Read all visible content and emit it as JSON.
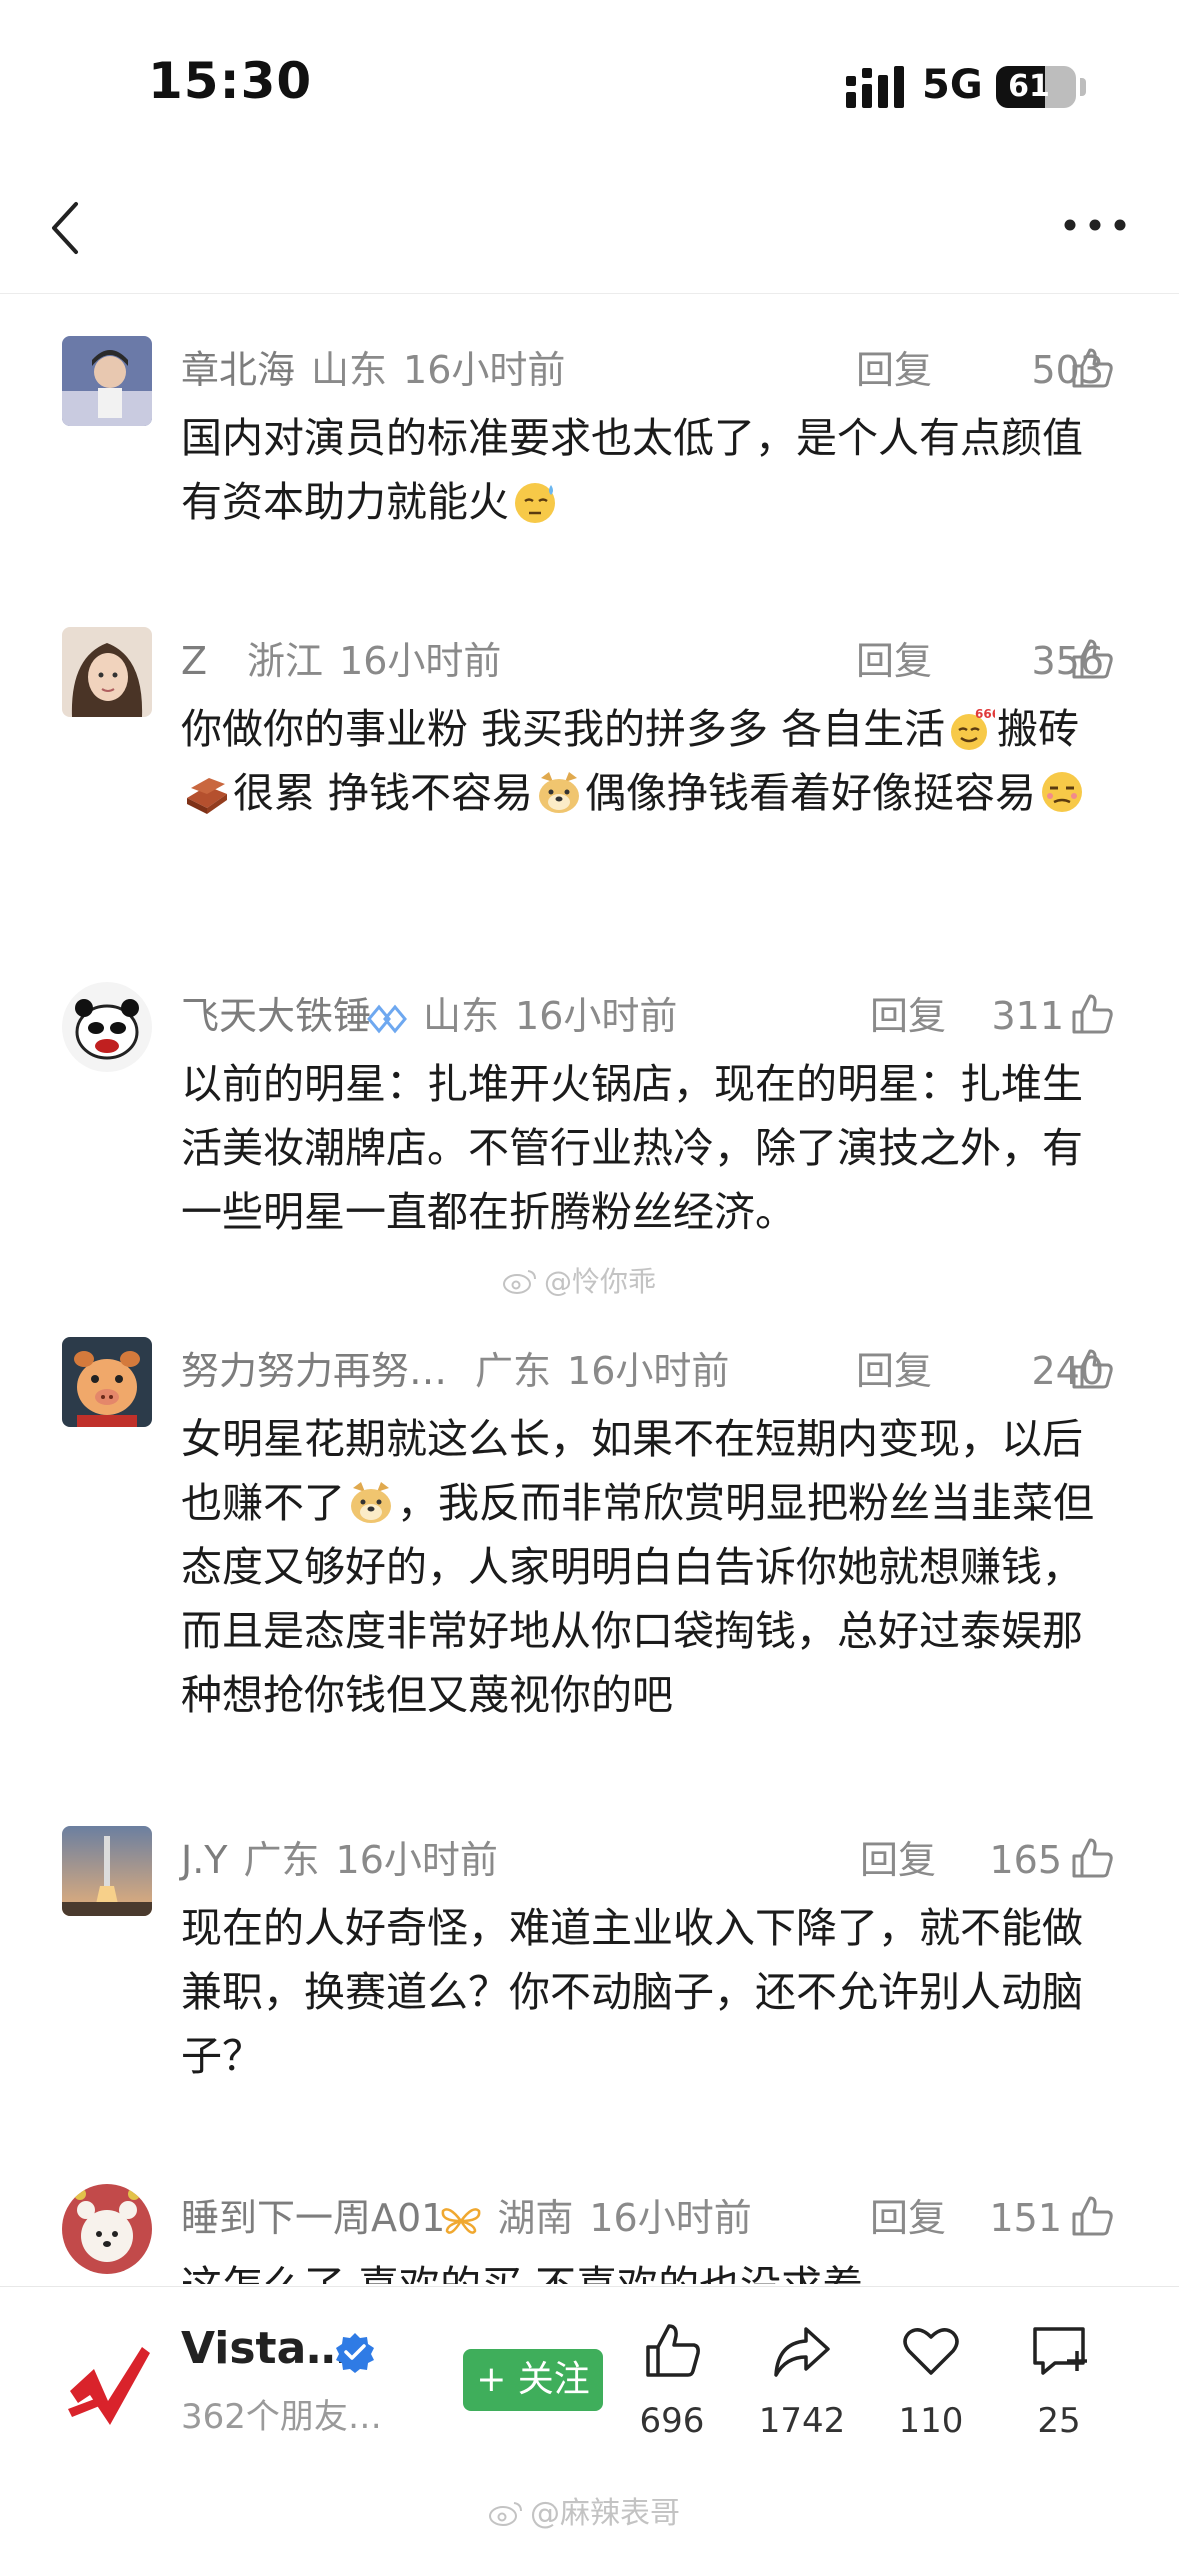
{
  "status_bar": {
    "time": "15:30",
    "network": "5G",
    "battery": "61",
    "battery_level": 0.61
  },
  "nav": {
    "back_icon": "chevron-left-icon",
    "more_icon": "ellipsis-icon"
  },
  "reply_label": "回复",
  "comments": [
    {
      "name": "章北海",
      "location": "山东",
      "time": "16小时前",
      "likes": "503",
      "text_1": "国内对演员的标准要求也太低了，是个人有点颜值有资本助力就能火"
    },
    {
      "name": "Z",
      "location": "浙江",
      "time": "16小时前",
      "likes": "356",
      "text_1": "你做你的事业粉 我买我的拼多多 各自生活",
      "text_2": "搬砖",
      "text_3": "很累 挣钱不容易",
      "text_4": "偶像挣钱看着好像挺容易"
    },
    {
      "name": "飞天大铁锤",
      "location": "山东",
      "time": "16小时前",
      "likes": "311",
      "text_1": "以前的明星：扎堆开火锅店，现在的明星：扎堆生活美妆潮牌店。不管行业热冷，除了演技之外，有一些明星一直都在折腾粉丝经济。"
    },
    {
      "name": "努力努力再努…",
      "location": "广东",
      "time": "16小时前",
      "likes": "240",
      "text_1": "女明星花期就这么长，如果不在短期内变现，以后也赚不了",
      "text_2": "，我反而非常欣赏明显把粉丝当韭菜但态度又够好的，人家明明白白告诉你她就想赚钱，而且是态度非常好地从你口袋掏钱，总好过泰娱那种想抢你钱但又蔑视你的吧"
    },
    {
      "name": "J.Y",
      "location": "广东",
      "time": "16小时前",
      "likes": "165",
      "text_1": "现在的人好奇怪，难道主业收入下降了，就不能做兼职，换赛道么？你不动脑子，还不允许别人动脑子？"
    },
    {
      "name": "睡到下一周A01",
      "location": "湖南",
      "time": "16小时前",
      "likes": "151",
      "text_1": "这怎么了 喜欢的买 不喜欢的也没求着"
    }
  ],
  "watermarks": {
    "middle": "@怜你乖",
    "bottom": "@麻辣表哥"
  },
  "author": {
    "name": "Vista…",
    "subtitle": "362个朋友…"
  },
  "follow_label": "+ 关注",
  "actions": {
    "like": "696",
    "share": "1742",
    "favorite": "110",
    "comment": "25"
  },
  "colors": {
    "follow_green": "#3fae5b",
    "verify_blue": "#2f7be5",
    "gray_text": "#8a8a8a"
  }
}
